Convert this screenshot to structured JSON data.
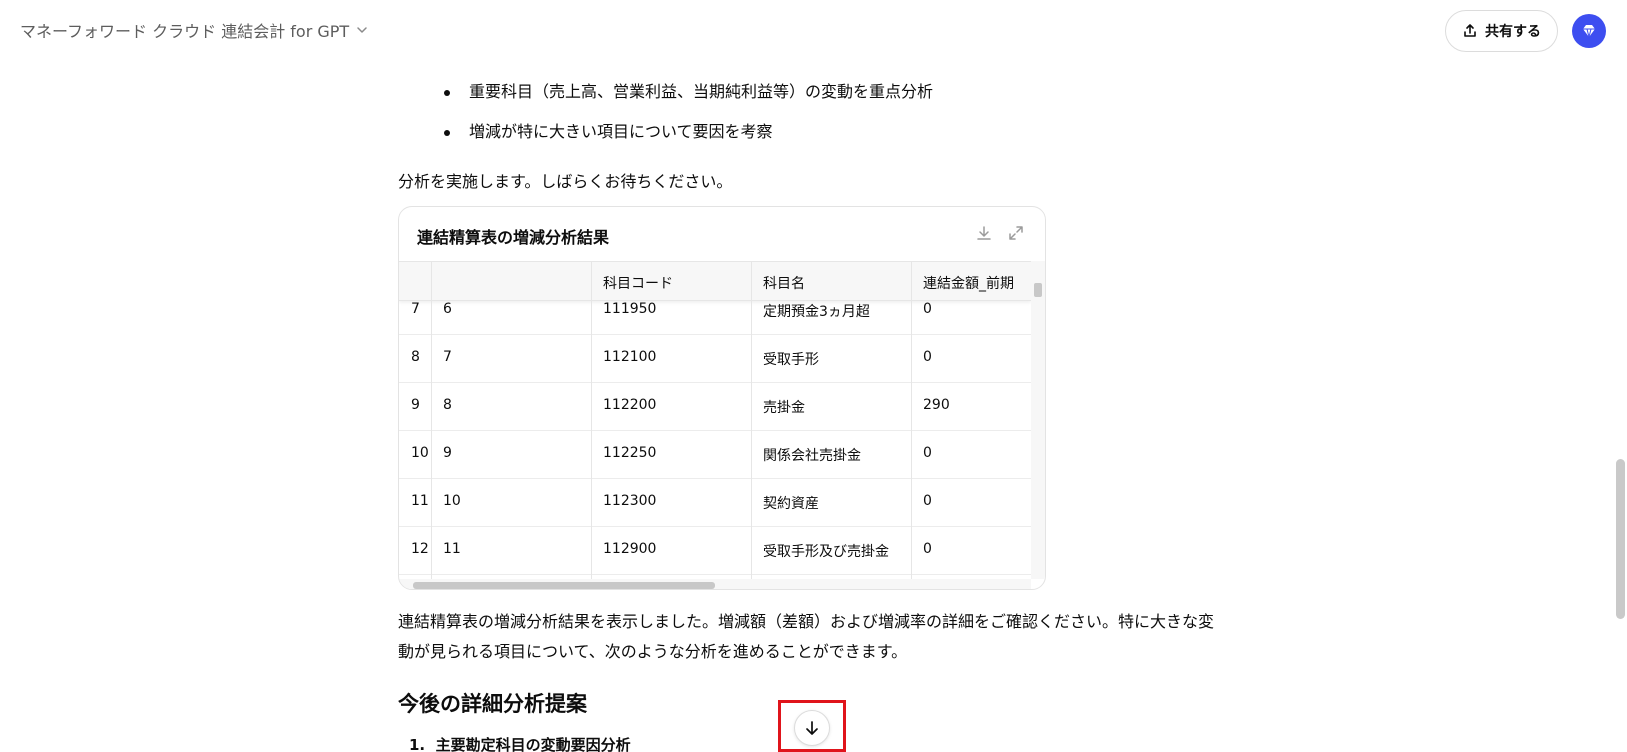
{
  "header": {
    "model_title": "マネーフォワード クラウド 連結会計 for GPT",
    "share_label": "共有する",
    "icons": [
      "chevron-down-icon",
      "share-upload-icon",
      "gpt-diamond-icon"
    ],
    "avatar_color": "#3d4ef0"
  },
  "message": {
    "bullets": [
      "重要科目（売上高、営業利益、当期純利益等）の変動を重点分析",
      "増減が特に大きい項目について要因を考察"
    ],
    "intro": "分析を実施します。しばらくお待ちください。",
    "table": {
      "title": "連結精算表の増減分析結果",
      "icons": [
        "download-icon",
        "expand-icon"
      ],
      "columns": [
        "",
        "",
        "科目コード",
        "科目名",
        "連結金額_前期"
      ],
      "rows": [
        [
          "7",
          "6",
          "111950",
          "定期預金3ヵ月超",
          "0"
        ],
        [
          "8",
          "7",
          "112100",
          "受取手形",
          "0"
        ],
        [
          "9",
          "8",
          "112200",
          "売掛金",
          "290"
        ],
        [
          "10",
          "9",
          "112250",
          "関係会社売掛金",
          "0"
        ],
        [
          "11",
          "10",
          "112300",
          "契約資産",
          "0"
        ],
        [
          "12",
          "11",
          "112900",
          "受取手形及び売掛金",
          "0"
        ]
      ]
    },
    "summary_line1": "連結精算表の増減分析結果を表示しました。増減額（差額）および増減率の詳細をご確認ください。特に大きな変",
    "summary_line2": "動が見られる項目について、次のような分析を進めることができます。",
    "section_heading": "今後の詳細分析提案",
    "ordered_items": [
      "主要勘定科目の変動要因分析"
    ]
  },
  "scroll_down_icon": "arrow-down-icon",
  "highlight_color": "#e0141b"
}
